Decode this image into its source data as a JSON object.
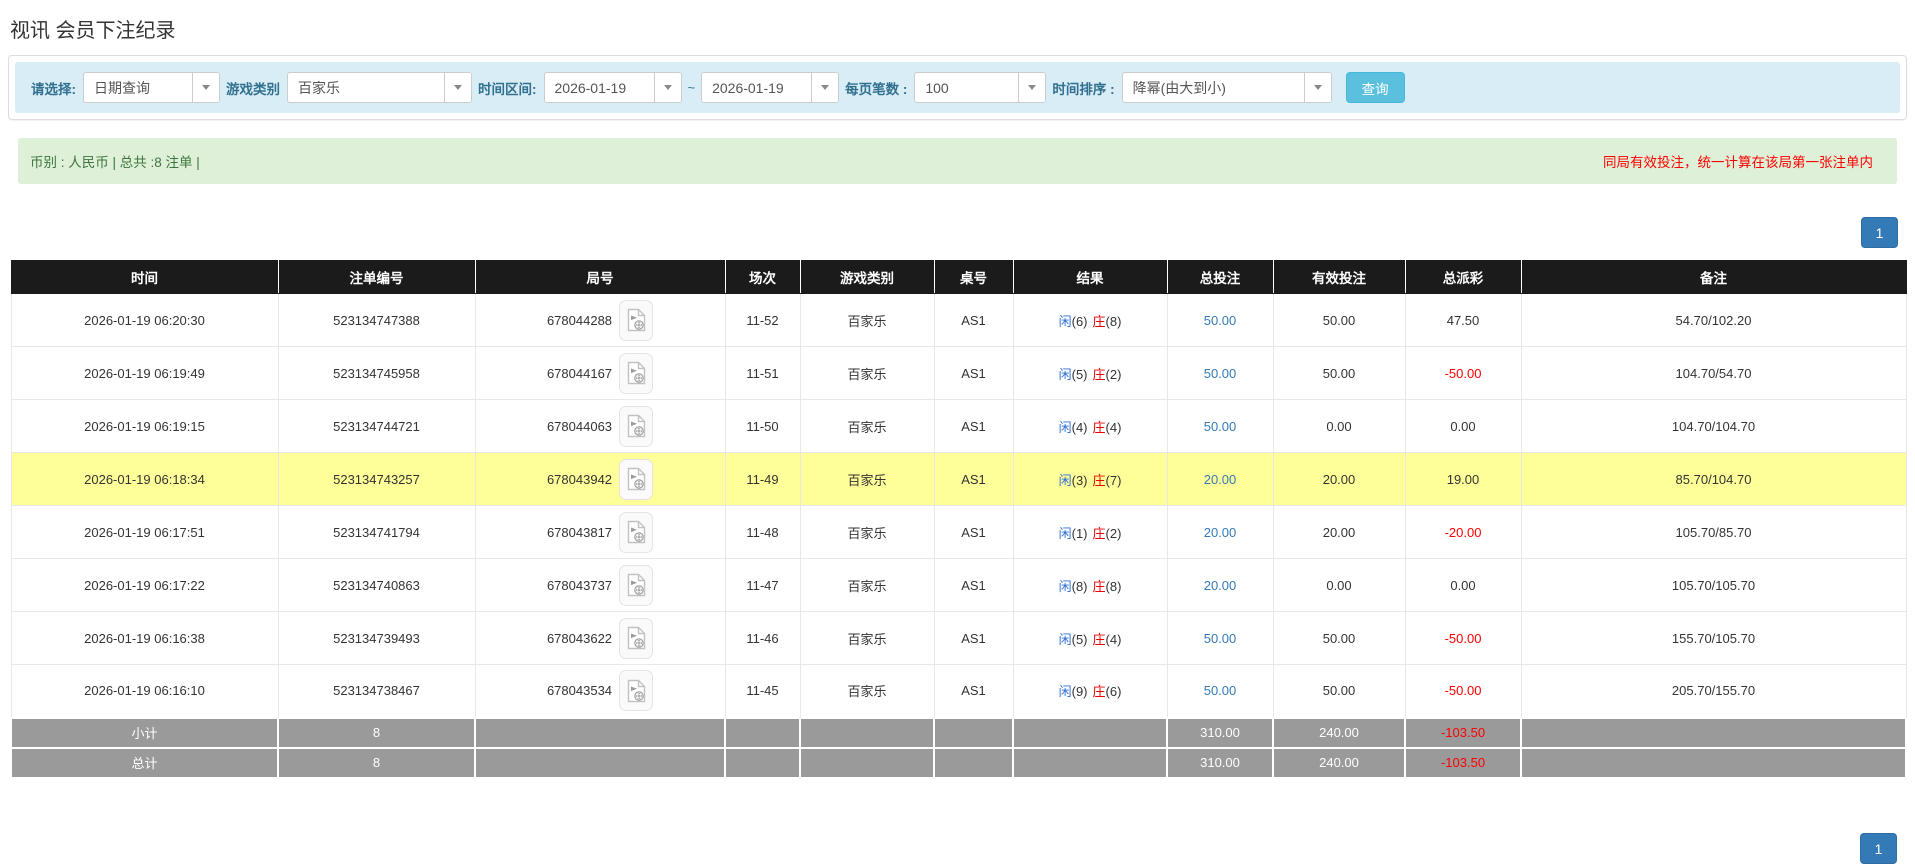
{
  "page": {
    "title": "视讯 会员下注纪录"
  },
  "filter_bar": {
    "select_type": {
      "label": "请选择:",
      "value": "日期查询"
    },
    "game_category": {
      "label": "游戏类别",
      "value": "百家乐"
    },
    "time_range": {
      "label": "时间区间:",
      "from": "2026-01-19",
      "tilde": "~",
      "to": "2026-01-19"
    },
    "page_size": {
      "label": "每页笔数 :",
      "value": "100"
    },
    "time_sort": {
      "label": "时间排序 :",
      "value": "降幂(由大到小)"
    },
    "search_button_label": "查询"
  },
  "info_bar": {
    "currency_summary": "币别 : 人民币 | 总共 :8 注单 |",
    "notice": "同局有效投注，统一计算在该局第一张注单内"
  },
  "pagination": {
    "page": "1"
  },
  "table": {
    "headers": [
      "时间",
      "注单编号",
      "局号",
      "场次",
      "游戏类别",
      "桌号",
      "结果",
      "总投注",
      "有效投注",
      "总派彩",
      "备注"
    ],
    "rows": [
      {
        "time": "2026-01-19 06:20:30",
        "bet_id": "523134747388",
        "round_id": "678044288",
        "session": "11-52",
        "game": "百家乐",
        "table_no": "AS1",
        "player_label": "闲",
        "player_score": "(6)",
        "banker_label": "庄",
        "banker_score": "(8)",
        "total_bet": "50.00",
        "valid_bet": "50.00",
        "payout": "47.50",
        "remark": "54.70/102.20",
        "highlighted": false
      },
      {
        "time": "2026-01-19 06:19:49",
        "bet_id": "523134745958",
        "round_id": "678044167",
        "session": "11-51",
        "game": "百家乐",
        "table_no": "AS1",
        "player_label": "闲",
        "player_score": "(5)",
        "banker_label": "庄",
        "banker_score": "(2)",
        "total_bet": "50.00",
        "valid_bet": "50.00",
        "payout": "-50.00",
        "remark": "104.70/54.70",
        "highlighted": false
      },
      {
        "time": "2026-01-19 06:19:15",
        "bet_id": "523134744721",
        "round_id": "678044063",
        "session": "11-50",
        "game": "百家乐",
        "table_no": "AS1",
        "player_label": "闲",
        "player_score": "(4)",
        "banker_label": "庄",
        "banker_score": "(4)",
        "total_bet": "50.00",
        "valid_bet": "0.00",
        "payout": "0.00",
        "remark": "104.70/104.70",
        "highlighted": false
      },
      {
        "time": "2026-01-19 06:18:34",
        "bet_id": "523134743257",
        "round_id": "678043942",
        "session": "11-49",
        "game": "百家乐",
        "table_no": "AS1",
        "player_label": "闲",
        "player_score": "(3)",
        "banker_label": "庄",
        "banker_score": "(7)",
        "total_bet": "20.00",
        "valid_bet": "20.00",
        "payout": "19.00",
        "remark": "85.70/104.70",
        "highlighted": true
      },
      {
        "time": "2026-01-19 06:17:51",
        "bet_id": "523134741794",
        "round_id": "678043817",
        "session": "11-48",
        "game": "百家乐",
        "table_no": "AS1",
        "player_label": "闲",
        "player_score": "(1)",
        "banker_label": "庄",
        "banker_score": "(2)",
        "total_bet": "20.00",
        "valid_bet": "20.00",
        "payout": "-20.00",
        "remark": "105.70/85.70",
        "highlighted": false
      },
      {
        "time": "2026-01-19 06:17:22",
        "bet_id": "523134740863",
        "round_id": "678043737",
        "session": "11-47",
        "game": "百家乐",
        "table_no": "AS1",
        "player_label": "闲",
        "player_score": "(8)",
        "banker_label": "庄",
        "banker_score": "(8)",
        "total_bet": "20.00",
        "valid_bet": "0.00",
        "payout": "0.00",
        "remark": "105.70/105.70",
        "highlighted": false
      },
      {
        "time": "2026-01-19 06:16:38",
        "bet_id": "523134739493",
        "round_id": "678043622",
        "session": "11-46",
        "game": "百家乐",
        "table_no": "AS1",
        "player_label": "闲",
        "player_score": "(5)",
        "banker_label": "庄",
        "banker_score": "(4)",
        "total_bet": "50.00",
        "valid_bet": "50.00",
        "payout": "-50.00",
        "remark": "155.70/105.70",
        "highlighted": false
      },
      {
        "time": "2026-01-19 06:16:10",
        "bet_id": "523134738467",
        "round_id": "678043534",
        "session": "11-45",
        "game": "百家乐",
        "table_no": "AS1",
        "player_label": "闲",
        "player_score": "(9)",
        "banker_label": "庄",
        "banker_score": "(6)",
        "total_bet": "50.00",
        "valid_bet": "50.00",
        "payout": "-50.00",
        "remark": "205.70/155.70",
        "highlighted": false
      }
    ],
    "subtotal": {
      "label": "小计",
      "count": "8",
      "total_bet": "310.00",
      "valid_bet": "240.00",
      "payout": "-103.50"
    },
    "grand_total": {
      "label": "总计",
      "count": "8",
      "total_bet": "310.00",
      "valid_bet": "240.00",
      "payout": "-103.50"
    }
  },
  "colors": {
    "header_bg": "#1b1b1b",
    "row_highlight": "#ffff99",
    "link_blue": "#337ab7",
    "player_blue": "#2e6fd8",
    "banker_red": "#e60000",
    "negative_red": "#ff0000",
    "search_btn": "#5bc0de",
    "pager_blue": "#337ab7",
    "info_bar_bg": "#d9edf7",
    "info_label": "#31708f",
    "green_bar_bg": "#dff0d8",
    "green_bar_text": "#3c763d"
  }
}
